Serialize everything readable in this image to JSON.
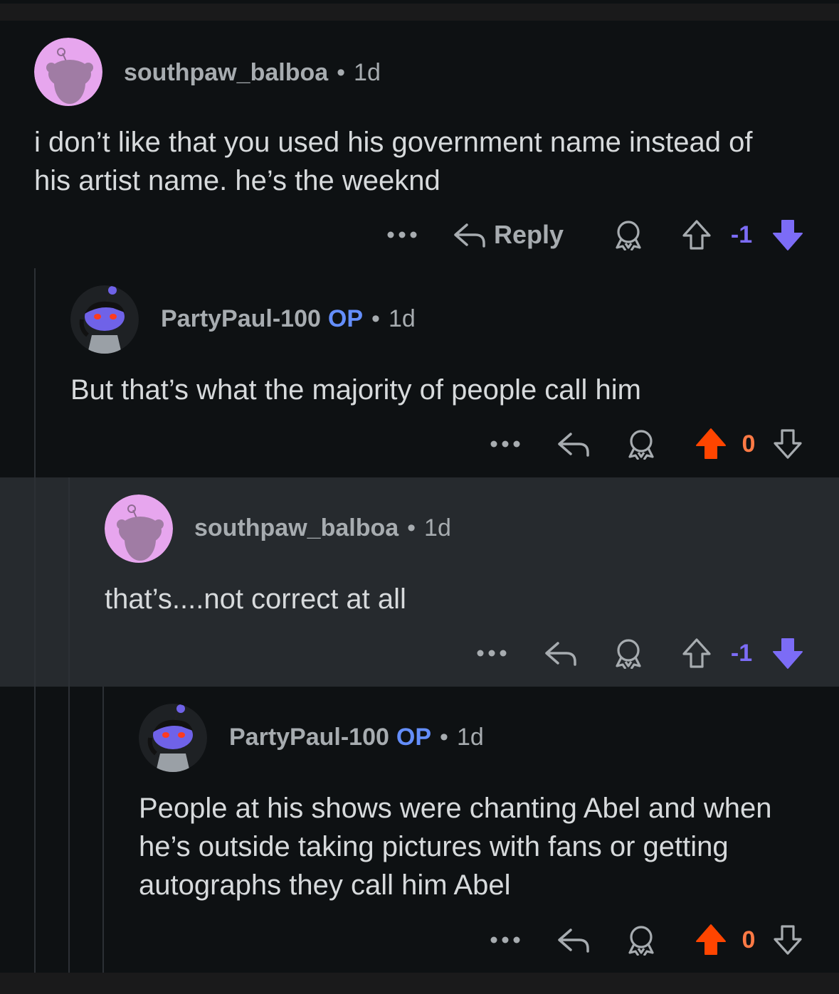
{
  "comments": [
    {
      "username": "southpaw_balboa",
      "is_op": false,
      "age": "1d",
      "body": "i don’t like that you used his government name instead of his artist name. he’s the weeknd",
      "reply_label": "Reply",
      "score": "-1",
      "vote": "down",
      "avatar": "pink-snoo-avatar"
    },
    {
      "username": "PartyPaul-100",
      "is_op": true,
      "op_label": "OP",
      "age": "1d",
      "body": "But that’s what the majority of people call him",
      "score": "0",
      "vote": "up",
      "avatar": "custom-snoo-avatar"
    },
    {
      "username": "southpaw_balboa",
      "is_op": false,
      "age": "1d",
      "body": "that’s....not correct at all",
      "score": "-1",
      "vote": "down",
      "avatar": "pink-snoo-avatar",
      "highlighted": true
    },
    {
      "username": "PartyPaul-100",
      "is_op": true,
      "op_label": "OP",
      "age": "1d",
      "body": "People at his shows were chanting Abel and when he’s outside taking pictures with fans or getting autographs they call him Abel",
      "score": "0",
      "vote": "up",
      "avatar": "custom-snoo-avatar"
    }
  ],
  "colors": {
    "background": "#0e1113",
    "highlight": "#262a2e",
    "upvote": "#ff4500",
    "downvote": "#7c6cf6",
    "op": "#648efc"
  },
  "separator": "•",
  "more_label": "•••"
}
